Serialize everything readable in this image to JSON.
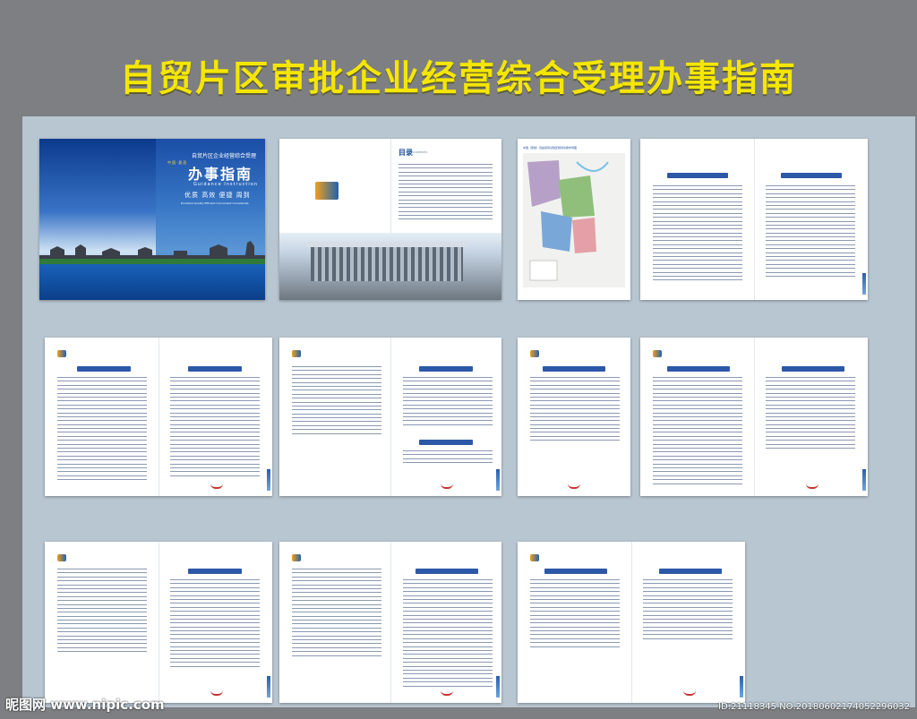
{
  "title": "自贸片区审批企业经营综合受理办事指南",
  "cover": {
    "heading": "自贸片区企业经营综合受理",
    "title": "办事指南",
    "subtitle": "Guidance Instruction",
    "slogan": "优质 高效 便捷 周到",
    "slogan_sub": "Excellent Quality  Efficient  Convenient  Considerate",
    "logo_text": "中国·夏邑"
  },
  "toc": {
    "title": "目录",
    "title_sub": "CONTENTS"
  },
  "map": {
    "caption": "中国（夏邑）自由贸易试验区规划功能布局图"
  },
  "watermark": {
    "left": "昵图网 www.nipic.com",
    "right": "ID:21118345 NO:20180602174052296032"
  }
}
